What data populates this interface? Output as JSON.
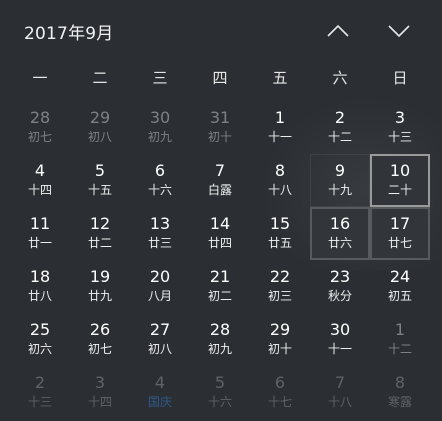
{
  "header": {
    "title": "2017年9月",
    "prev_icon": "chevron-up-icon",
    "next_icon": "chevron-down-icon"
  },
  "weekdays": [
    "一",
    "二",
    "三",
    "四",
    "五",
    "六",
    "日"
  ],
  "days": [
    {
      "num": "28",
      "lunar": "初七",
      "state": "other"
    },
    {
      "num": "29",
      "lunar": "初八",
      "state": "other"
    },
    {
      "num": "30",
      "lunar": "初九",
      "state": "other"
    },
    {
      "num": "31",
      "lunar": "初十",
      "state": "other"
    },
    {
      "num": "1",
      "lunar": "十一",
      "state": "normal"
    },
    {
      "num": "2",
      "lunar": "十二",
      "state": "normal"
    },
    {
      "num": "3",
      "lunar": "十三",
      "state": "normal"
    },
    {
      "num": "4",
      "lunar": "十四",
      "state": "normal"
    },
    {
      "num": "5",
      "lunar": "十五",
      "state": "normal"
    },
    {
      "num": "6",
      "lunar": "十六",
      "state": "normal"
    },
    {
      "num": "7",
      "lunar": "白露",
      "state": "normal"
    },
    {
      "num": "8",
      "lunar": "十八",
      "state": "normal"
    },
    {
      "num": "9",
      "lunar": "十九",
      "state": "hl"
    },
    {
      "num": "10",
      "lunar": "二十",
      "state": "today"
    },
    {
      "num": "11",
      "lunar": "廿一",
      "state": "normal"
    },
    {
      "num": "12",
      "lunar": "廿二",
      "state": "normal"
    },
    {
      "num": "13",
      "lunar": "廿三",
      "state": "normal"
    },
    {
      "num": "14",
      "lunar": "廿四",
      "state": "normal"
    },
    {
      "num": "15",
      "lunar": "廿五",
      "state": "normal"
    },
    {
      "num": "16",
      "lunar": "廿六",
      "state": "hl-strong"
    },
    {
      "num": "17",
      "lunar": "廿七",
      "state": "hl-strong"
    },
    {
      "num": "18",
      "lunar": "廿八",
      "state": "normal"
    },
    {
      "num": "19",
      "lunar": "廿九",
      "state": "normal"
    },
    {
      "num": "20",
      "lunar": "八月",
      "state": "normal"
    },
    {
      "num": "21",
      "lunar": "初二",
      "state": "normal"
    },
    {
      "num": "22",
      "lunar": "初三",
      "state": "normal"
    },
    {
      "num": "23",
      "lunar": "秋分",
      "state": "normal"
    },
    {
      "num": "24",
      "lunar": "初五",
      "state": "normal"
    },
    {
      "num": "25",
      "lunar": "初六",
      "state": "normal"
    },
    {
      "num": "26",
      "lunar": "初七",
      "state": "normal"
    },
    {
      "num": "27",
      "lunar": "初八",
      "state": "normal"
    },
    {
      "num": "28",
      "lunar": "初九",
      "state": "normal"
    },
    {
      "num": "29",
      "lunar": "初十",
      "state": "normal"
    },
    {
      "num": "30",
      "lunar": "十一",
      "state": "normal"
    },
    {
      "num": "1",
      "lunar": "十二",
      "state": "other"
    },
    {
      "num": "2",
      "lunar": "十三",
      "state": "bottom"
    },
    {
      "num": "3",
      "lunar": "十四",
      "state": "bottom"
    },
    {
      "num": "4",
      "lunar": "国庆",
      "state": "bottom-blue"
    },
    {
      "num": "5",
      "lunar": "十六",
      "state": "bottom"
    },
    {
      "num": "6",
      "lunar": "十七",
      "state": "bottom"
    },
    {
      "num": "7",
      "lunar": "十八",
      "state": "bottom"
    },
    {
      "num": "8",
      "lunar": "寒露",
      "state": "bottom"
    }
  ],
  "colors": {
    "background": "#2b2f33",
    "today_border": "#9a9a9a",
    "holiday_blue": "#2f5a8a"
  }
}
